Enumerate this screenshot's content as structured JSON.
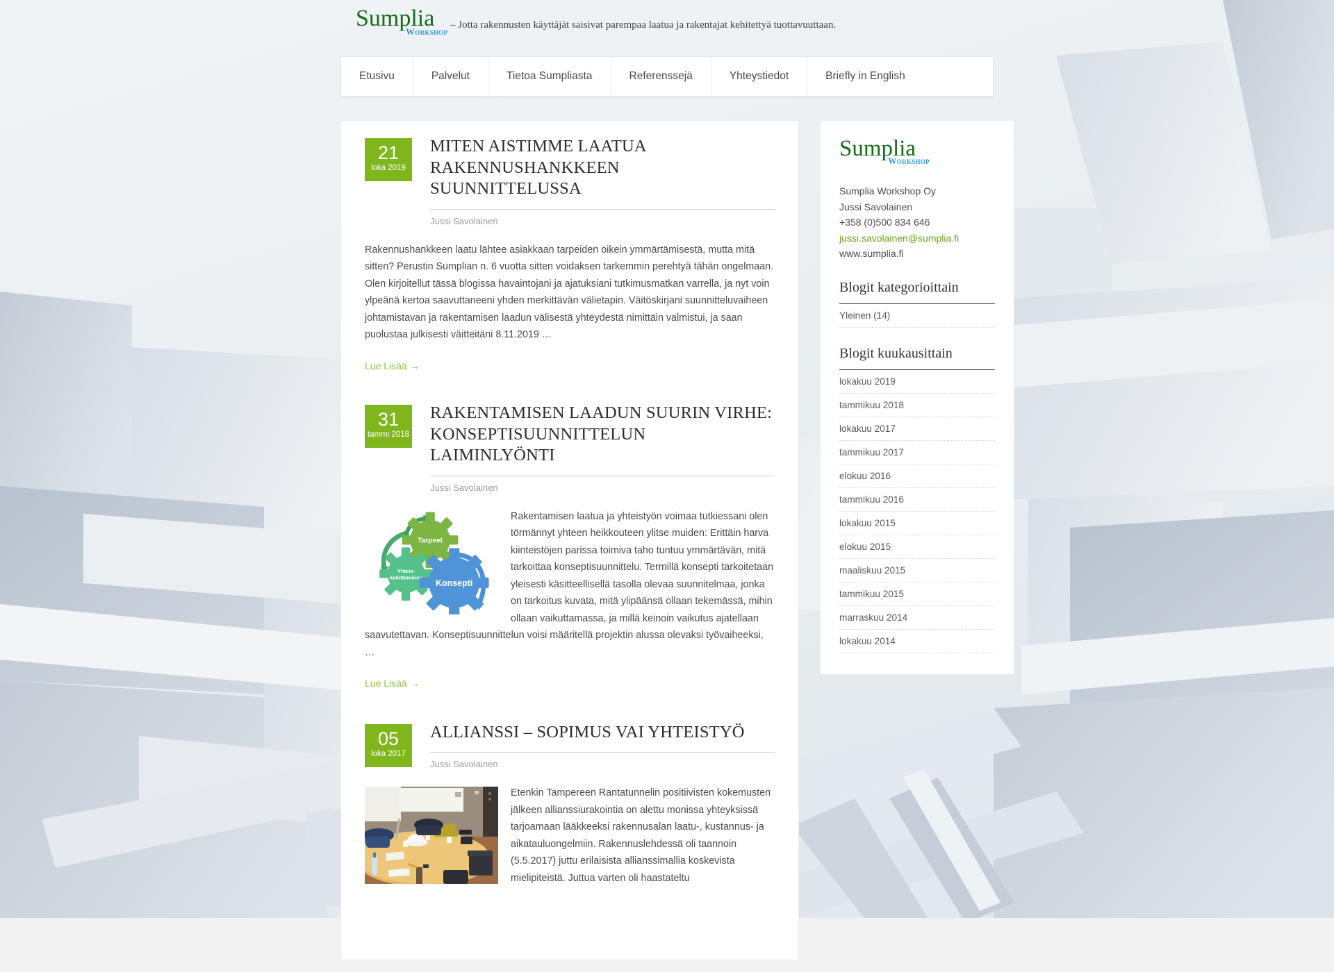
{
  "header": {
    "logo_main": "Sumplia",
    "logo_sub": "Workshop",
    "tagline": "– Jotta rakennusten käyttäjät saisivat parempaa laatua ja rakentajat kehitettyä tuottavuuttaan."
  },
  "nav": {
    "items": [
      {
        "label": "Etusivu"
      },
      {
        "label": "Palvelut"
      },
      {
        "label": "Tietoa Sumpliasta"
      },
      {
        "label": "Referenssejä"
      },
      {
        "label": "Yhteystiedot"
      },
      {
        "label": "Briefly in English"
      }
    ]
  },
  "posts": [
    {
      "day": "21",
      "month": "loka 2019",
      "title": "Miten aistimme laatua rakennushankkeen suunnittelussa",
      "author": "Jussi Savolainen",
      "body": "Rakennushankkeen laatu lähtee asiakkaan tarpeiden oikein ymmärtämisestä, mutta mitä sitten? Perustin Sumplian n. 6 vuotta sitten voidaksen tarkemmin perehtyä tähän ongelmaan. Olen kirjoitellut tässä blogissa havaintojani ja ajatuksiani tutkimusmatkan varrella, ja nyt voin ylpeänä kertoa saavuttaneeni yhden merkittävän välietapin. Väitöskirjani suunnitteluvaiheen johtamistavan ja rakentamisen laadun välisestä yhteydestä nimittäin valmistui, ja saan puolustaa julkisesti väitteitäni 8.11.2019 …",
      "read_more": "Lue Lisää →",
      "thumb": "none"
    },
    {
      "day": "31",
      "month": "tammi 2018",
      "title": "Rakentamisen laadun suurin virhe: konseptisuunnittelun laiminlyönti",
      "author": "Jussi Savolainen",
      "body": "Rakentamisen laatua ja yhteistyön voimaa tutkiessani olen törmännyt yhteen heikkouteen ylitse muiden: Erittäin harva kiinteistöjen parissa toimiva taho tuntuu ymmärtävän, mitä tarkoittaa konseptisuunnittelu. Termillä konsepti tarkoitetaan yleisesti käsitteellisellä tasolla olevaa suunnitelmaa, jonka on tarkoitus kuvata, mitä ylipäänsä ollaan tekemässä, mihin ollaan vaikuttamassa, ja millä keinoin vaikutus ajatellaan saavutettavan. Konseptisuunnittelun voisi määritellä projektin alussa olevaksi työvaiheeksi, …",
      "read_more": "Lue Lisää →",
      "thumb": "gear-diagram",
      "thumb_labels": {
        "top": "Tarpeet",
        "left_1": "Yhteis-",
        "left_2": "kehittäminen",
        "right": "Konsepti"
      }
    },
    {
      "day": "05",
      "month": "loka 2017",
      "title": "Allianssi – sopimus vai yhteistyö",
      "author": "Jussi Savolainen",
      "body": "Etenkin Tampereen Rantatunnelin positiivisten kokemusten jälkeen allianssiurakointia on alettu monissa yhteyksissä tarjoamaan lääkkeeksi rakennusalan laatu-, kustannus- ja aikatauluongelmiin. Rakennuslehdessä oli taannoin (5.5.2017) juttu erilaisista allianssimallia koskevista mielipiteistä. Juttua varten oli haastateltu",
      "thumb": "meeting-room-photo"
    }
  ],
  "sidebar": {
    "logo_main": "Sumplia",
    "logo_sub": "Workshop",
    "contact": [
      {
        "text": "Sumplia Workshop Oy",
        "is_link": false
      },
      {
        "text": "Jussi Savolainen",
        "is_link": false
      },
      {
        "text": "+358 (0)500 834 646",
        "is_link": false
      },
      {
        "text": "jussi.savolainen@sumplia.fi",
        "is_link": true
      },
      {
        "text": "www.sumplia.fi",
        "is_link": false
      }
    ],
    "categories_widget": {
      "title": "Blogit kategorioittain",
      "items": [
        {
          "label": "Yleinen (14)"
        }
      ]
    },
    "archives_widget": {
      "title": "Blogit kuukausittain",
      "items": [
        {
          "label": "lokakuu 2019"
        },
        {
          "label": "tammikuu 2018"
        },
        {
          "label": "lokakuu 2017"
        },
        {
          "label": "tammikuu 2017"
        },
        {
          "label": "elokuu 2016"
        },
        {
          "label": "tammikuu 2016"
        },
        {
          "label": "lokakuu 2015"
        },
        {
          "label": "elokuu 2015"
        },
        {
          "label": "maaliskuu 2015"
        },
        {
          "label": "tammikuu 2015"
        },
        {
          "label": "marraskuu 2014"
        },
        {
          "label": "lokakuu 2014"
        }
      ]
    }
  },
  "colors": {
    "brand_green": "#156b16",
    "brand_blue": "#2b9ae0",
    "accent_green": "#7fb61c",
    "link_green": "#8cc63e",
    "page_bg": "#e9edf0"
  }
}
